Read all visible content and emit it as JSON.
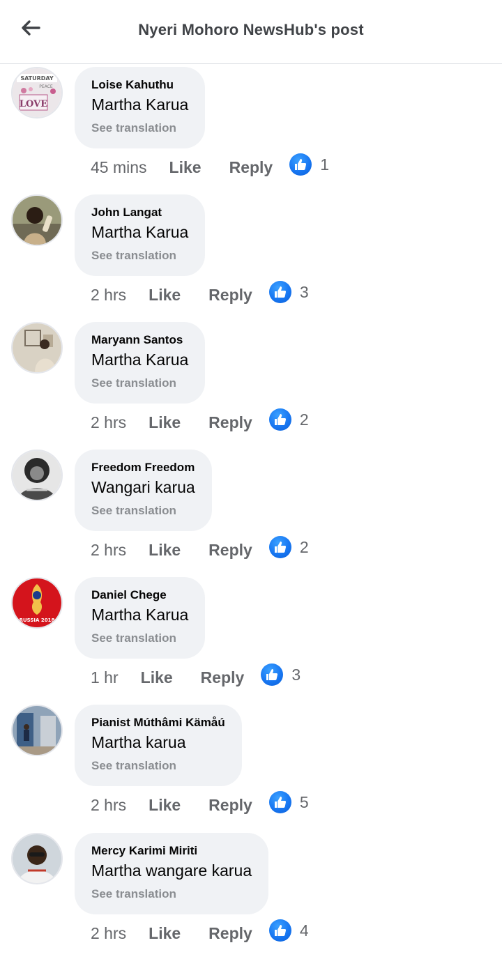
{
  "header": {
    "title": "Nyeri Mohoro NewsHub's post"
  },
  "comments": [
    {
      "author": "Loise Kahuthu",
      "text": "Martha Karua",
      "see_translation": "See translation",
      "time": "45 mins",
      "like_label": "Like",
      "reply_label": "Reply",
      "reactions": "1",
      "avatar_lines": [
        "SATURDAY",
        "PEACE",
        "LOVE"
      ]
    },
    {
      "author": "John Langat",
      "text": "Martha Karua",
      "see_translation": "See translation",
      "time": "2 hrs",
      "like_label": "Like",
      "reply_label": "Reply",
      "reactions": "3"
    },
    {
      "author": "Maryann Santos",
      "text": "Martha Karua",
      "see_translation": "See translation",
      "time": "2 hrs",
      "like_label": "Like",
      "reply_label": "Reply",
      "reactions": "2"
    },
    {
      "author": "Freedom Freedom",
      "text": "Wangari karua",
      "see_translation": "See translation",
      "time": "2 hrs",
      "like_label": "Like",
      "reply_label": "Reply",
      "reactions": "2"
    },
    {
      "author": "Daniel Chege",
      "text": "Martha Karua",
      "see_translation": "See translation",
      "time": "1 hr",
      "like_label": "Like",
      "reply_label": "Reply",
      "reactions": "3",
      "avatar_lines": [
        "RUSSIA 2018"
      ]
    },
    {
      "author": "Pianist Múthâmi Kämåú",
      "text": "Martha karua",
      "see_translation": "See translation",
      "time": "2 hrs",
      "like_label": "Like",
      "reply_label": "Reply",
      "reactions": "5"
    },
    {
      "author": "Mercy Karimi Miriti",
      "text": "Martha wangare karua",
      "see_translation": "See translation",
      "time": "2 hrs",
      "like_label": "Like",
      "reply_label": "Reply",
      "reactions": "4"
    }
  ],
  "colors": {
    "bubble": "#f0f2f5",
    "secondary_text": "#65676b",
    "muted_text": "#8a8d91",
    "like_blue": "#1877f2"
  },
  "icons": {
    "back": "arrow-left-icon",
    "reaction": "thumbs-up-icon"
  }
}
